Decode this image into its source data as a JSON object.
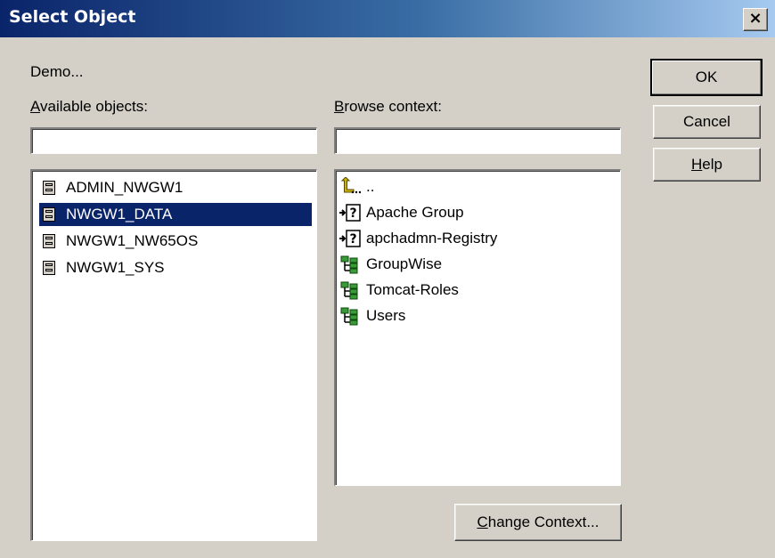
{
  "window": {
    "title": "Select Object",
    "close_label": "×"
  },
  "context_name": "Demo...",
  "available": {
    "label_mnemonic": "A",
    "label_rest": "vailable objects:",
    "filter_value": "",
    "items": [
      {
        "label": "ADMIN_NWGW1",
        "icon": "volume-icon",
        "selected": false
      },
      {
        "label": "NWGW1_DATA",
        "icon": "volume-icon",
        "selected": true
      },
      {
        "label": "NWGW1_NW65OS",
        "icon": "volume-icon",
        "selected": false
      },
      {
        "label": "NWGW1_SYS",
        "icon": "volume-icon",
        "selected": false
      }
    ]
  },
  "browse": {
    "label_mnemonic": "B",
    "label_rest": "rowse context:",
    "filter_value": "",
    "items": [
      {
        "label": "..",
        "icon": "parent-up-icon"
      },
      {
        "label": "Apache Group",
        "icon": "unknown-object-icon"
      },
      {
        "label": "apchadmn-Registry",
        "icon": "unknown-object-icon"
      },
      {
        "label": "GroupWise",
        "icon": "organizational-unit-icon"
      },
      {
        "label": "Tomcat-Roles",
        "icon": "organizational-unit-icon"
      },
      {
        "label": "Users",
        "icon": "organizational-unit-icon"
      }
    ]
  },
  "buttons": {
    "ok": "OK",
    "cancel": "Cancel",
    "help_mnemonic": "H",
    "help_rest": "elp",
    "change_mnemonic": "C",
    "change_rest": "hange Context..."
  },
  "colors": {
    "selection": "#0a246a",
    "face": "#d4d0c8"
  }
}
